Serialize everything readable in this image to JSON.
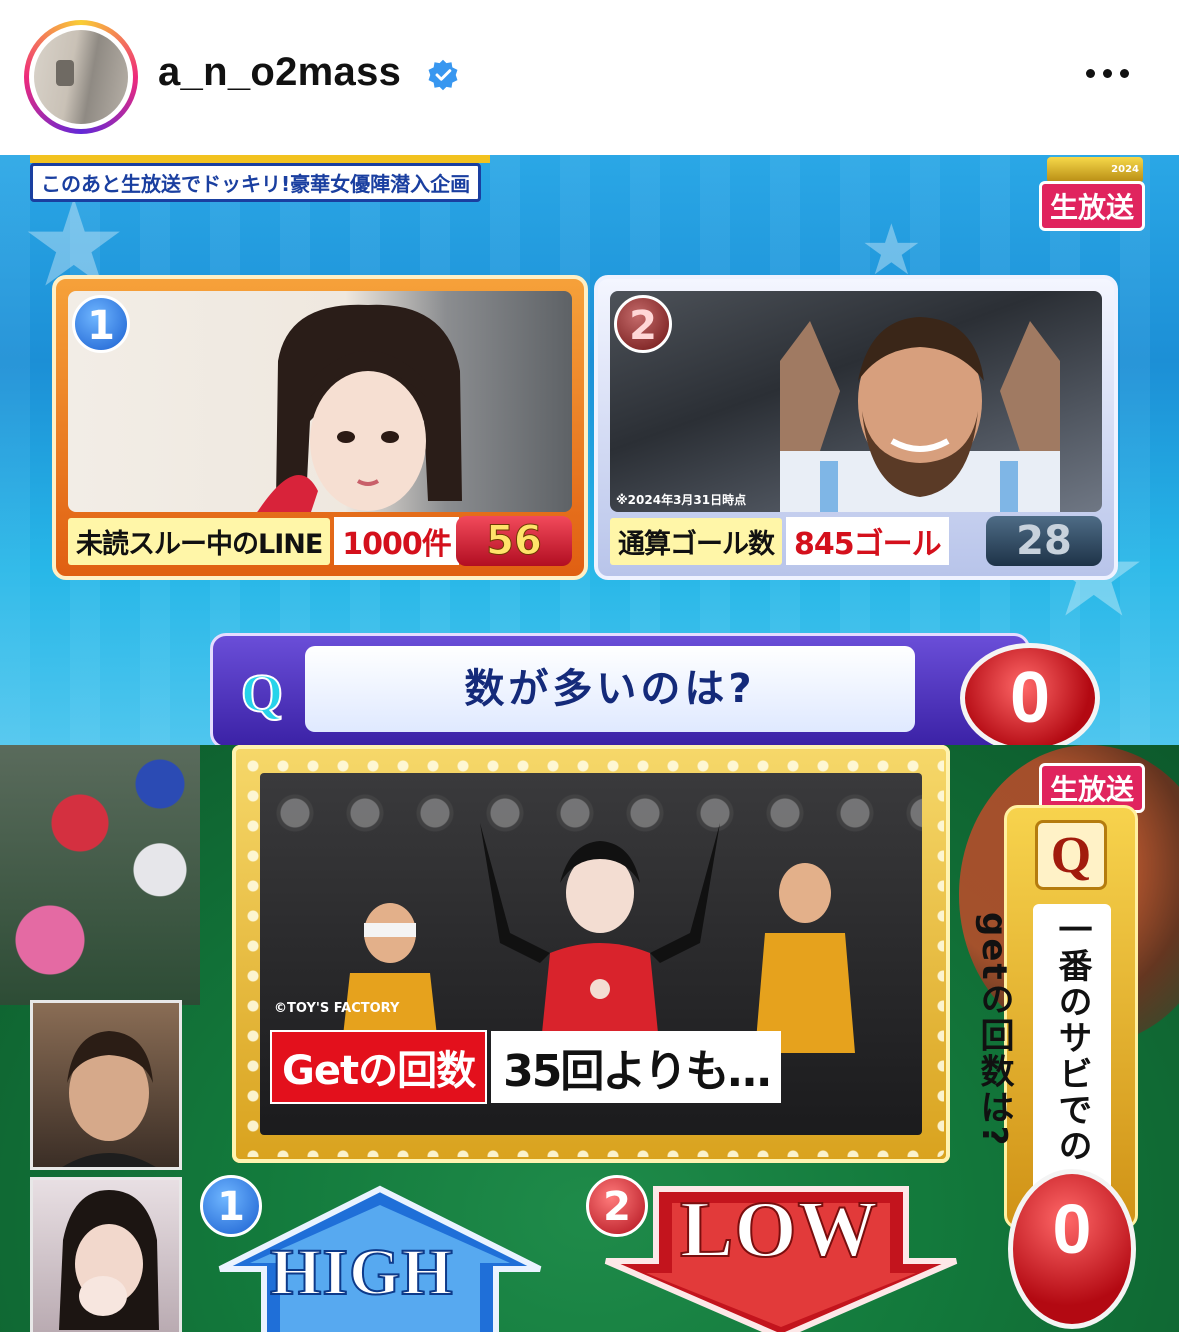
{
  "header": {
    "username": "a_n_o2mass",
    "verified_icon": "verified-badge-icon",
    "more_icon": "more-horizontal-icon"
  },
  "top_panel": {
    "telop": "このあと生放送でドッキリ!豪華女優陣潜入企画",
    "live_badge": "生放送",
    "logo_year": "2024",
    "cards": [
      {
        "number": "1",
        "label": "未読スルー中のLINE",
        "value": "1000件",
        "score": "56"
      },
      {
        "number": "2",
        "note": "※2024年3月31日時点",
        "label": "通算ゴール数",
        "value": "845ゴール",
        "score": "28"
      }
    ],
    "question_mark": "Q",
    "question": "数が多いのは?",
    "counter": "0"
  },
  "bottom_panel": {
    "live_badge": "生放送",
    "copyright": "©TOY'S FACTORY",
    "caption_label": "Getの回数",
    "caption_value": "35回よりも…",
    "question_mark": "Q",
    "question_vertical": "一番のサビでのgetの回数は?",
    "options": [
      {
        "number": "1",
        "label": "HIGH"
      },
      {
        "number": "2",
        "label": "LOW"
      }
    ],
    "counter": "0"
  },
  "colors": {
    "accent_red": "#d4101c",
    "verified_blue": "#3897f0",
    "question_purple": "#3b22a6",
    "frame_gold": "#d9a21e"
  }
}
